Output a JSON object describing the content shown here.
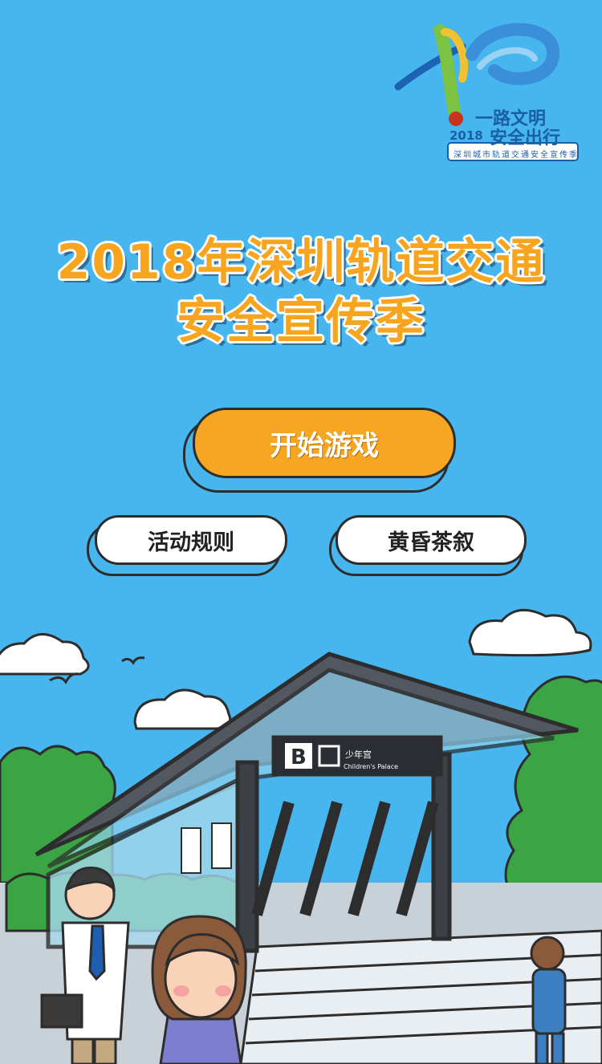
{
  "logo": {
    "line1": "一路文明",
    "line2": "安全出行",
    "year": "2018",
    "subtitle": "深圳城市轨道交通安全宣传季"
  },
  "title": {
    "line1": "2018年深圳轨道交通",
    "line2": "安全宣传季"
  },
  "buttons": {
    "start": "开始游戏",
    "rules": "活动规则",
    "chat": "黄昏茶叙"
  },
  "station_sign": {
    "exit_letter": "B",
    "name_cn": "少年宫",
    "name_en": "Children's Palace"
  },
  "colors": {
    "sky": "#47b5ee",
    "accent_orange": "#f6a623",
    "title_orange": "#f7a51f"
  }
}
